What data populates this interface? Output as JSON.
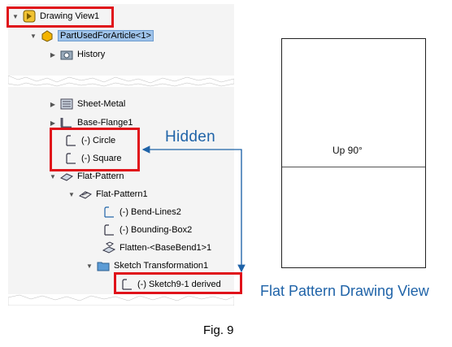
{
  "tree": {
    "root": {
      "label": "Drawing View1",
      "icon": "drawing-view-icon"
    },
    "part": {
      "label": "PartUsedForArticle<1>",
      "icon": "part-icon"
    },
    "items": [
      {
        "label": "History",
        "icon": "history-folder-icon"
      },
      {
        "label": "Sheet-Metal",
        "icon": "sheet-metal-icon"
      },
      {
        "label": "Base-Flange1",
        "icon": "base-flange-icon"
      },
      {
        "label": "(-) Circle",
        "icon": "sketch-icon"
      },
      {
        "label": "(-) Square",
        "icon": "sketch-icon"
      },
      {
        "label": "Flat-Pattern",
        "icon": "flat-pattern-icon"
      },
      {
        "label": "Flat-Pattern1",
        "icon": "flat-pattern-feature-icon"
      },
      {
        "label": "(-) Bend-Lines2",
        "icon": "sketch-icon"
      },
      {
        "label": "(-) Bounding-Box2",
        "icon": "sketch-icon"
      },
      {
        "label": "Flatten-<BaseBend1>1",
        "icon": "flatten-icon"
      },
      {
        "label": "Sketch Transformation1",
        "icon": "folder-icon"
      },
      {
        "label": "(-) Sketch9-1 derived",
        "icon": "sketch-icon"
      }
    ]
  },
  "annotation": {
    "hidden_label": "Hidden"
  },
  "drawing": {
    "bend_note": "Up  90°",
    "caption": "Flat Pattern Drawing View"
  },
  "figure": {
    "label": "Fig. 9"
  },
  "colors": {
    "highlight_red": "#e0121a",
    "annotation_blue": "#1f63a8",
    "selection_blue": "#9fc3ea"
  }
}
